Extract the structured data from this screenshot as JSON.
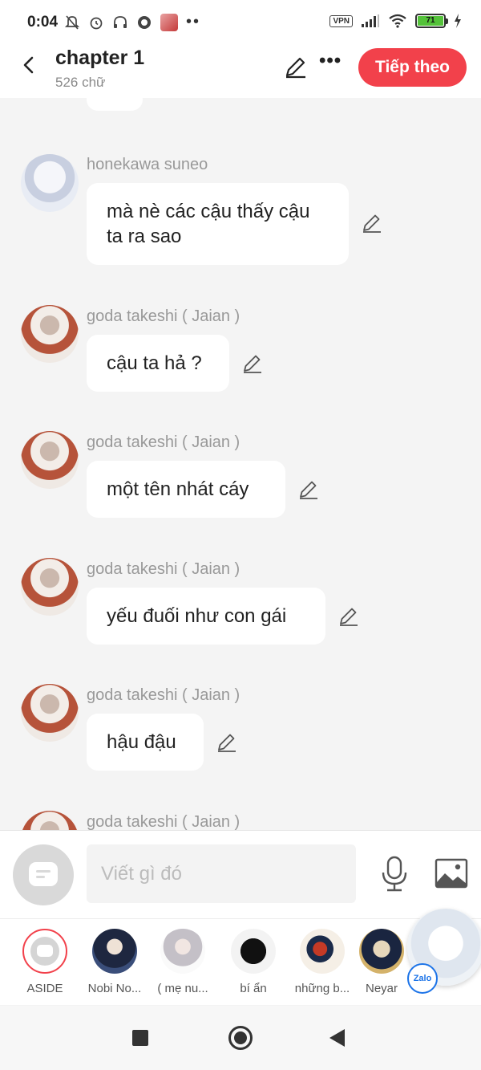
{
  "status_bar": {
    "time": "0:04",
    "vpn": "VPN",
    "battery": "71"
  },
  "header": {
    "title": "chapter 1",
    "subtitle": "526 chữ",
    "next_label": "Tiếp theo"
  },
  "messages": [
    {
      "sender": "honekawa suneo",
      "text": "mà nè các cậu thấy cậu ta ra sao"
    },
    {
      "sender": "goda takeshi ( Jaian )",
      "text": "cậu ta hả ?"
    },
    {
      "sender": "goda takeshi ( Jaian )",
      "text": "một tên nhát cáy"
    },
    {
      "sender": "goda takeshi ( Jaian )",
      "text": "yếu đuối như con gái"
    },
    {
      "sender": "goda takeshi ( Jaian )",
      "text": "hậu đậu"
    },
    {
      "sender": "goda takeshi ( Jaian )",
      "text": ""
    }
  ],
  "composer": {
    "placeholder": "Viết gì đó"
  },
  "characters": [
    {
      "label": "ASIDE"
    },
    {
      "label": "Nobi No..."
    },
    {
      "label": "( mẹ nu..."
    },
    {
      "label": "bí ẩn"
    },
    {
      "label": "những b..."
    },
    {
      "label": "Neyar"
    }
  ],
  "floating": {
    "badge": "Zalo"
  },
  "colors": {
    "accent": "#f2414b",
    "background": "#f4f4f4",
    "bubble": "#ffffff",
    "sender_text": "#999999"
  }
}
